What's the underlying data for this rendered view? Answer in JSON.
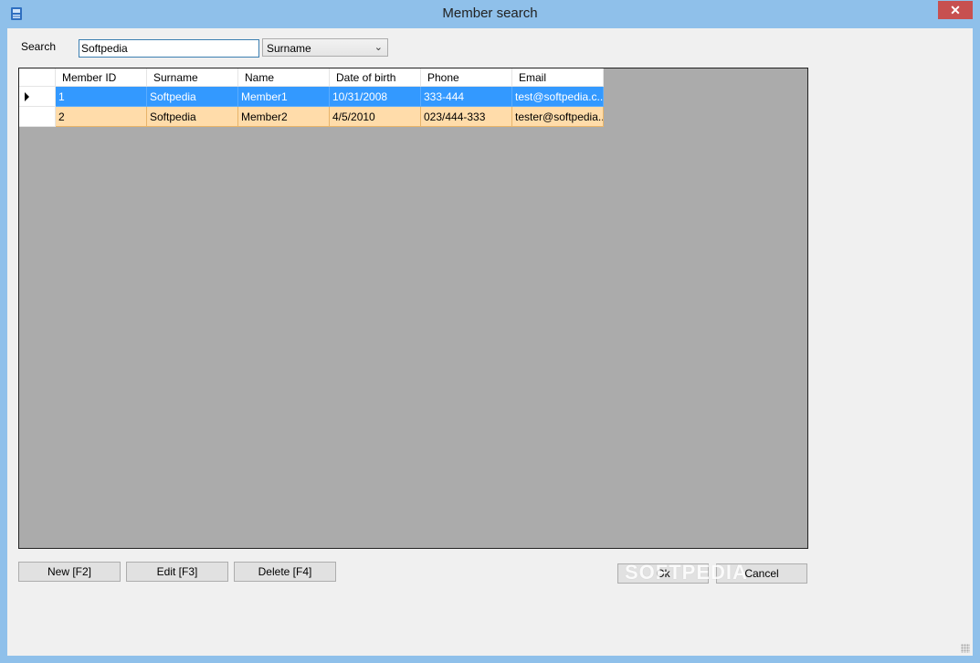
{
  "window": {
    "title": "Member search",
    "close": "✕"
  },
  "search": {
    "label": "Search",
    "value": "Softpedia",
    "field": "Surname"
  },
  "grid": {
    "columns": [
      "Member ID",
      "Surname",
      "Name",
      "Date of birth",
      "Phone",
      "Email"
    ],
    "rows": [
      {
        "id": "1",
        "surname": "Softpedia",
        "name": "Member1",
        "dob": "10/31/2008",
        "phone": "333-444",
        "email": "test@softpedia.c..."
      },
      {
        "id": "2",
        "surname": "Softpedia",
        "name": "Member2",
        "dob": "4/5/2010",
        "phone": "023/444-333",
        "email": "tester@softpedia...."
      }
    ]
  },
  "buttons": {
    "new": "New  [F2]",
    "edit": "Edit  [F3]",
    "delete": "Delete  [F4]",
    "ok": "Ok",
    "cancel": "Cancel"
  },
  "watermark": "SOFTPEDIA",
  "colors": {
    "selected_row": "#3399ff",
    "alt_row": "#ffdcaa",
    "grid_bg": "#ababab",
    "titlebar": "#8fc0ea",
    "close": "#c75050"
  }
}
